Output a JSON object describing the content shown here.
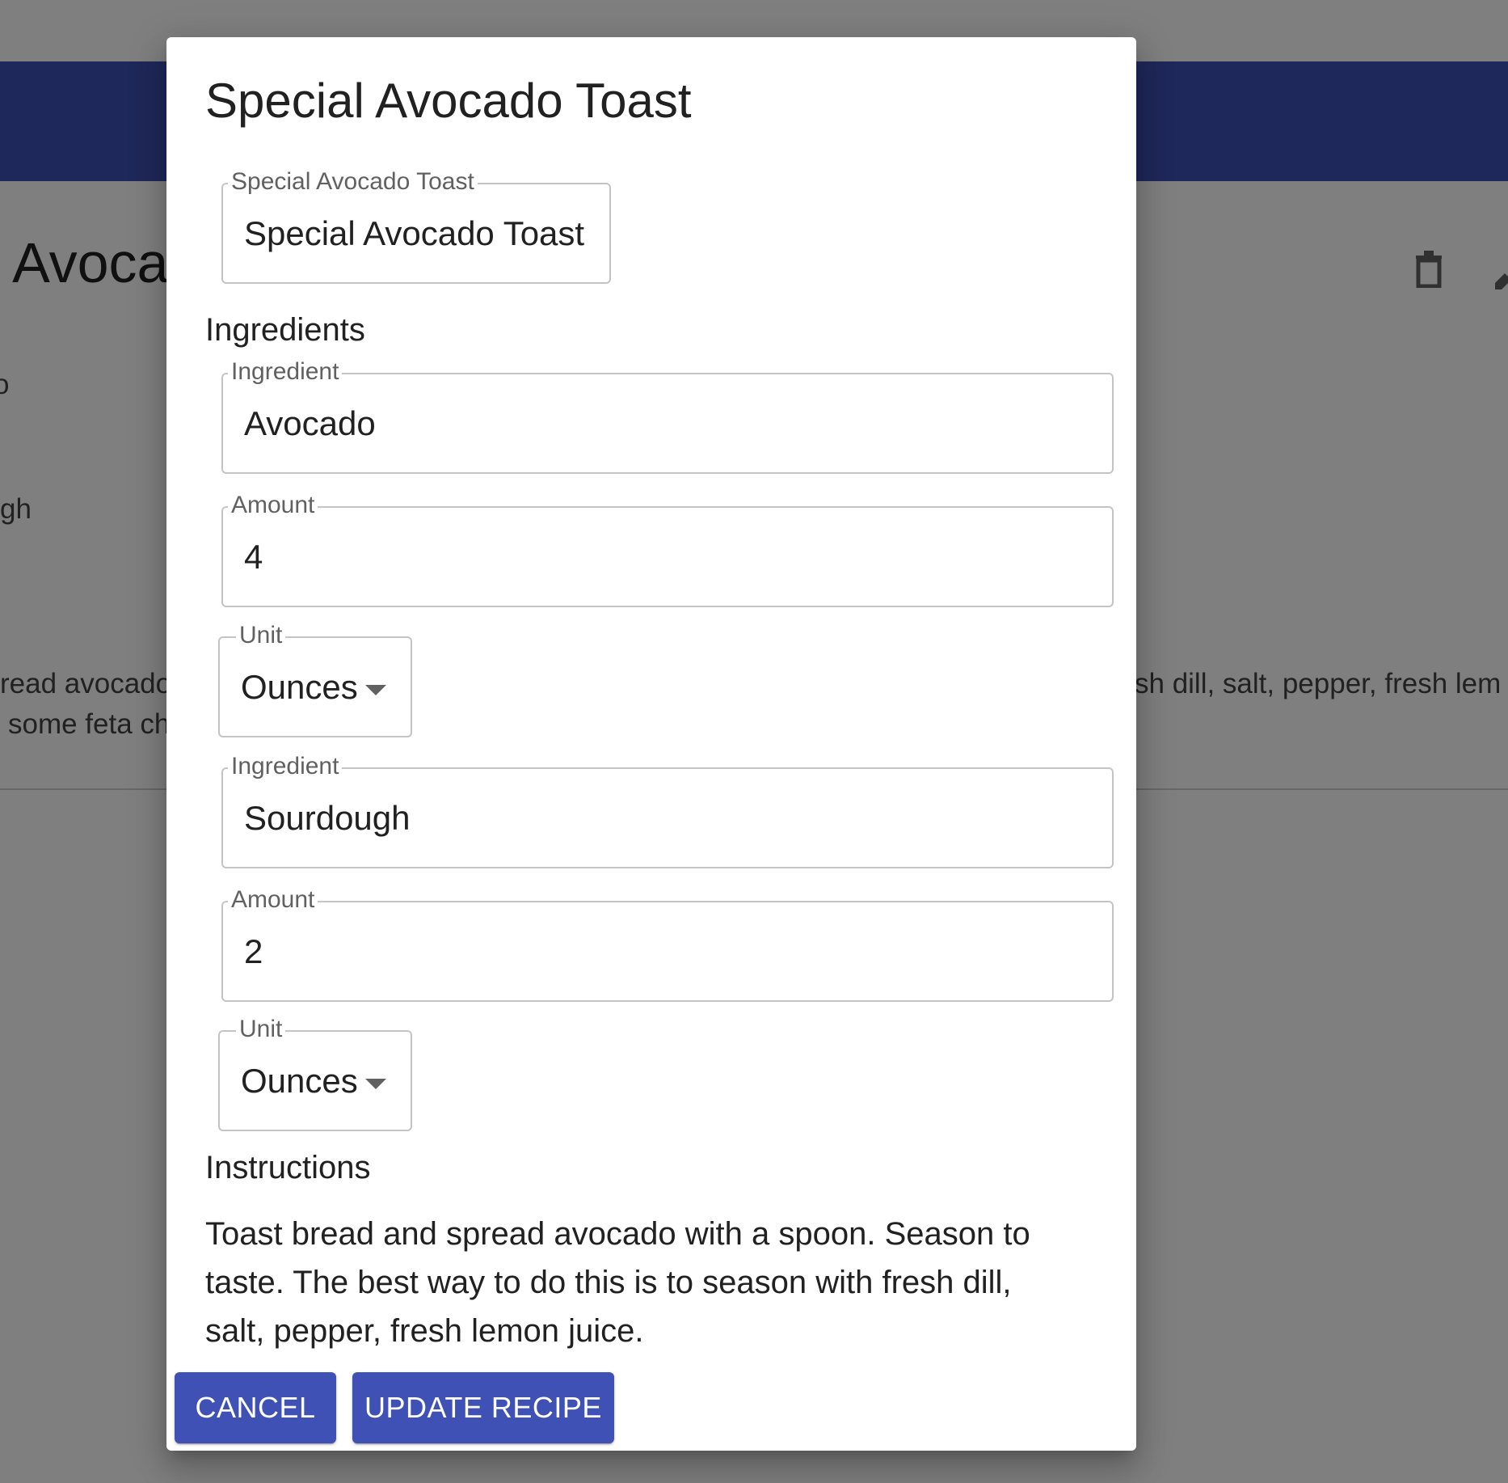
{
  "background": {
    "page_title": "Special Avocado Toast",
    "side_text_1": "o",
    "side_text_2": "gh",
    "description_line_1_left": "read avocado",
    "description_line_2_left": "some feta ch",
    "description_line_1_right": "sh dill, salt, pepper, fresh lem",
    "delete_icon": "trash-icon",
    "edit_icon": "pencil-icon"
  },
  "dialog": {
    "title": "Special Avocado Toast",
    "name_field": {
      "label": "Special Avocado Toast",
      "value": "Special Avocado Toast"
    },
    "ingredients_heading": "Ingredients",
    "ingredients": [
      {
        "ingredient_label": "Ingredient",
        "ingredient_value": "Avocado",
        "amount_label": "Amount",
        "amount_value": "4",
        "unit_label": "Unit",
        "unit_value": "Ounces"
      },
      {
        "ingredient_label": "Ingredient",
        "ingredient_value": "Sourdough",
        "amount_label": "Amount",
        "amount_value": "2",
        "unit_label": "Unit",
        "unit_value": "Ounces"
      }
    ],
    "instructions_heading": "Instructions",
    "instructions_text": "Toast bread and spread avocado with a spoon. Season to taste. The best way to do this is to season with fresh dill, salt, pepper, fresh lemon juice.",
    "cancel_label": "CANCEL",
    "update_label": "UPDATE RECIPE"
  },
  "colors": {
    "primary": "#3f51b5",
    "overlay": "rgba(0,0,0,0.5)"
  }
}
